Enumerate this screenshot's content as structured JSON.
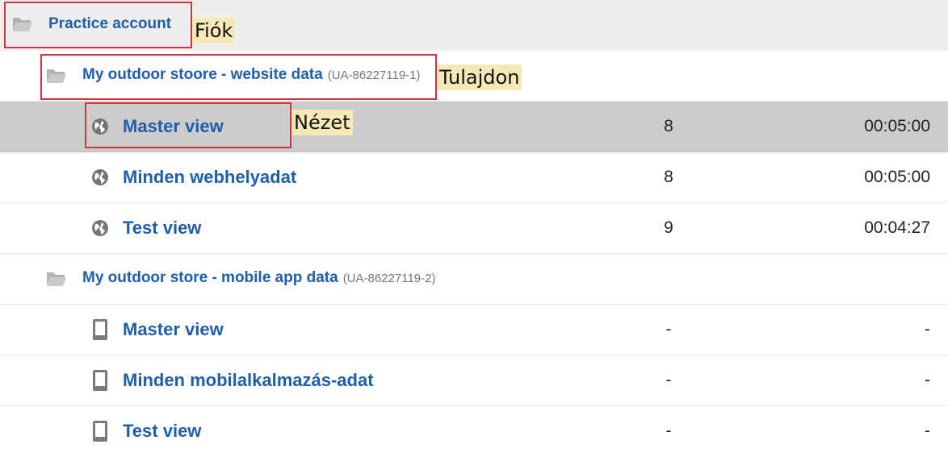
{
  "account": {
    "name": "Practice account"
  },
  "properties": [
    {
      "name": "My outdoor stoore - website data",
      "id": "(UA-86227119-1)",
      "views": [
        {
          "name": "Master view",
          "count": "8",
          "duration": "00:05:00",
          "selected": true,
          "icon": "globe-icon"
        },
        {
          "name": "Minden webhelyadat",
          "count": "8",
          "duration": "00:05:00",
          "icon": "globe-icon"
        },
        {
          "name": "Test view",
          "count": "9",
          "duration": "00:04:27",
          "icon": "globe-icon"
        }
      ]
    },
    {
      "name": "My outdoor store - mobile app data",
      "id": "(UA-86227119-2)",
      "views": [
        {
          "name": "Master view",
          "count": "-",
          "duration": "-",
          "icon": "mobile-icon"
        },
        {
          "name": "Minden mobilalkalmazás-adat",
          "count": "-",
          "duration": "-",
          "icon": "mobile-icon"
        },
        {
          "name": "Test view",
          "count": "-",
          "duration": "-",
          "icon": "mobile-icon"
        }
      ]
    }
  ],
  "annotations": {
    "account_tag": "Fiók",
    "property_tag": "Tulajdon",
    "view_tag": "Nézet"
  },
  "colors": {
    "link": "#1f5ea8",
    "selected_row": "#cccccc",
    "account_row": "#eeeeee",
    "highlight_border": "#d13438",
    "tag_background": "#f5e9b8"
  }
}
